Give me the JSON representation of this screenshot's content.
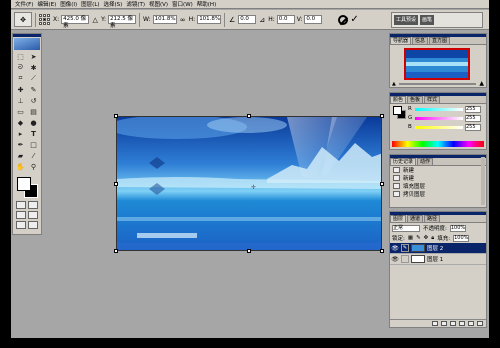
{
  "menu": [
    "文件(F)",
    "编辑(E)",
    "图像(I)",
    "图层(L)",
    "选择(S)",
    "滤镜(T)",
    "视图(V)",
    "窗口(W)",
    "帮助(H)"
  ],
  "options": {
    "x_label": "X:",
    "x_value": "425.0 像素",
    "y_label": "Y:",
    "y_value": "212.5 像素",
    "w_label": "W:",
    "w_value": "101.8%",
    "h_label": "H:",
    "h_value": "101.8%",
    "angle_value": "0.0",
    "skew_h_label": "H:",
    "skew_h_value": "0.0",
    "skew_v_label": "V:",
    "skew_v_value": "0.0",
    "palette_tab1": "工具预设",
    "palette_tab2": "画笔"
  },
  "navigator": {
    "tabs": [
      "导航器",
      "信息",
      "直方图"
    ]
  },
  "color": {
    "tabs": [
      "颜色",
      "色板",
      "样式"
    ],
    "channels": [
      {
        "label": "R",
        "value": "255",
        "gradient": "linear-gradient(90deg,#00ffff,#ffffff)"
      },
      {
        "label": "G",
        "value": "255",
        "gradient": "linear-gradient(90deg,#ff00ff,#ffffff)"
      },
      {
        "label": "B",
        "value": "255",
        "gradient": "linear-gradient(90deg,#ffff00,#ffffff)"
      }
    ]
  },
  "history": {
    "tabs": [
      "历史记录",
      "动作"
    ],
    "items": [
      {
        "label": "新建",
        "selected": false
      },
      {
        "label": "新建",
        "selected": false
      },
      {
        "label": "填充图层",
        "selected": false
      },
      {
        "label": "拷贝图层",
        "selected": false
      }
    ]
  },
  "layers": {
    "tabs": [
      "图层",
      "通道",
      "路径"
    ],
    "blend_mode": "正常",
    "opacity_label": "不透明度:",
    "opacity_value": "100%",
    "lock_label": "锁定:",
    "fill_label": "填充:",
    "fill_value": "100%",
    "items": [
      {
        "name": "图层 2",
        "selected": true,
        "thumb_color": "#3a8fd8"
      },
      {
        "name": "图层 1",
        "selected": false,
        "thumb_color": "#ffffff"
      }
    ]
  },
  "colors": {
    "accent": "#0a246a",
    "panel_bg": "#d4d0c8",
    "workspace": "#a6a6a6"
  }
}
